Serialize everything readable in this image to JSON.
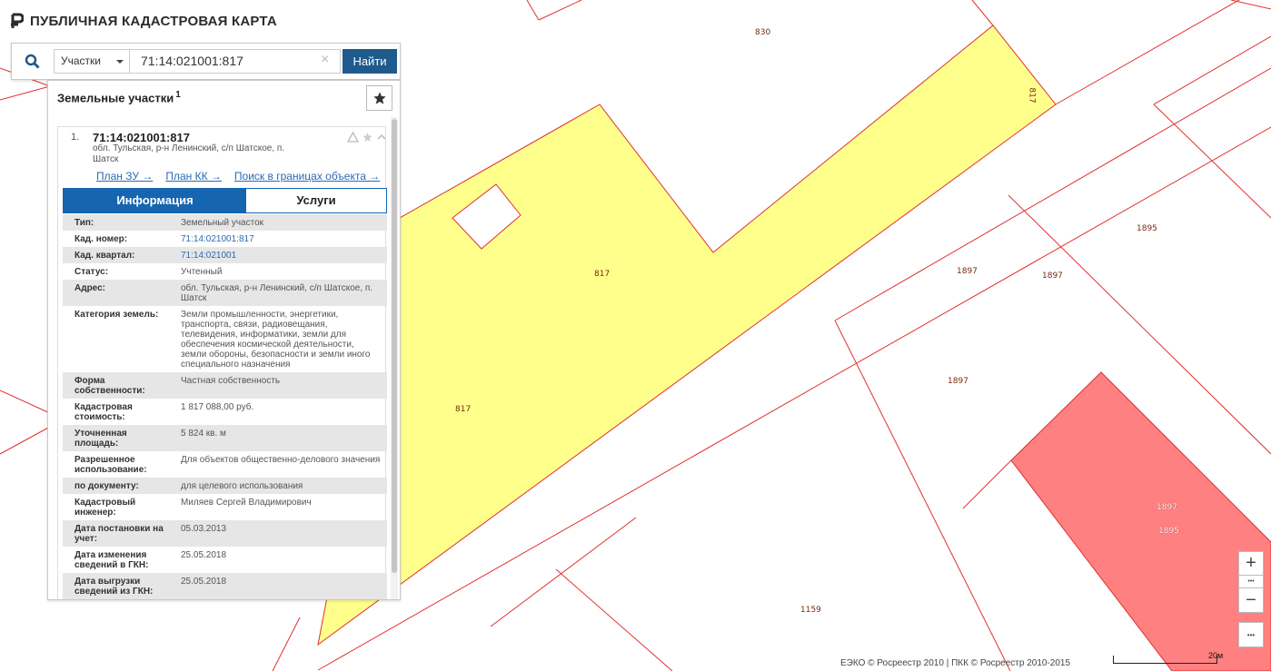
{
  "app": {
    "title": "ПУБЛИЧНАЯ КАДАСТРОВАЯ КАРТА"
  },
  "search": {
    "type_selected": "Участки",
    "query": "71:14:021001:817",
    "clear_symbol": "×",
    "find_label": "Найти"
  },
  "results": {
    "title": "Земельные участки",
    "count": "1",
    "fav_icon": "star-icon",
    "item": {
      "index": "1.",
      "cad_number": "71:14:021001:817",
      "address": "обл. Тульская, р-н Ленинский, с/п Шатское, п. Шатск",
      "links": {
        "plan_zu": "План ЗУ →",
        "plan_kk": "План КК →",
        "search_within": "Поиск в границах объекта →"
      },
      "tabs": {
        "info": "Информация",
        "services": "Услуги"
      },
      "info": [
        {
          "k": "Тип:",
          "v": "Земельный участок"
        },
        {
          "k": "Кад. номер:",
          "v": "71:14:021001:817"
        },
        {
          "k": "Кад. квартал:",
          "v": "71:14:021001"
        },
        {
          "k": "Статус:",
          "v": "Учтенный"
        },
        {
          "k": "Адрес:",
          "v": "обл. Тульская, р-н Ленинский, с/п Шатское, п. Шатск"
        },
        {
          "k": "Категория земель:",
          "v": "Земли промышленности, энергетики, транспорта, связи, радиовещания, телевидения, информатики, земли для обеспечения космической деятельности, земли обороны, безопасности и земли иного специального назначения"
        },
        {
          "k": "Форма собственности:",
          "v": "Частная собственность"
        },
        {
          "k": "Кадастровая стоимость:",
          "v": "1 817 088,00 руб."
        },
        {
          "k": "Уточненная площадь:",
          "v": "5 824 кв. м"
        },
        {
          "k": "Разрешенное использование:",
          "v": "Для объектов общественно-делового значения"
        },
        {
          "k": "по документу:",
          "v": "для целевого использования"
        },
        {
          "k": "Кадастровый инженер:",
          "v": "Миляев Сергей Владимирович"
        },
        {
          "k": "Дата постановки на учет:",
          "v": "05.03.2013"
        },
        {
          "k": "Дата изменения сведений в ГКН:",
          "v": "25.05.2018"
        },
        {
          "k": "Дата выгрузки сведений из ГКН:",
          "v": "25.05.2018"
        }
      ]
    }
  },
  "map": {
    "parcel_labels": [
      "830",
      "817",
      "817",
      "817",
      "1895",
      "1897",
      "1897",
      "1897",
      "1897",
      "1895",
      "1159"
    ],
    "colors": {
      "selected_parcel": "#ffff8c",
      "highlight_parcel": "#ff8080",
      "boundary": "#e03030"
    }
  },
  "controls": {
    "zoom_in": "+",
    "zoom_out": "−",
    "more": "•••"
  },
  "footer": {
    "attribution": "ЕЭКО © Росреестр 2010 | ПКК © Росреестр 2010-2015",
    "scale": "20м"
  }
}
